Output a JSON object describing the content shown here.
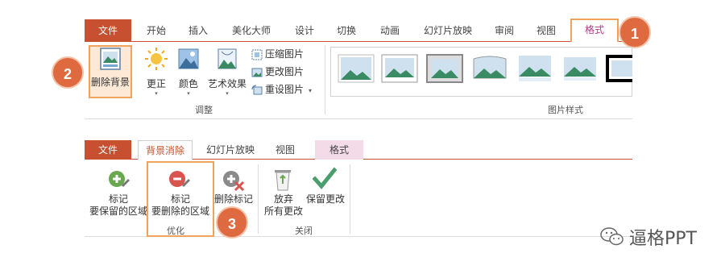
{
  "ribbon_top": {
    "tabs": [
      "文件",
      "开始",
      "插入",
      "美化大师",
      "设计",
      "切换",
      "动画",
      "幻灯片放映",
      "审阅",
      "视图",
      "格式"
    ],
    "buttons": {
      "remove_bg": "删除背景",
      "correct": "更正",
      "color": "颜色",
      "artistic": "艺术效果",
      "compress": "压缩图片",
      "change": "更改图片",
      "reset": "重设图片"
    },
    "groups": {
      "adjust": "调整",
      "picture_styles": "图片样式"
    }
  },
  "ribbon_bottom": {
    "tabs": [
      "文件",
      "背景消除",
      "幻灯片放映",
      "视图",
      "格式"
    ],
    "buttons": {
      "mark_keep_1": "标记",
      "mark_keep_2": "要保留的区域",
      "mark_remove_1": "标记",
      "mark_remove_2": "要删除的区域",
      "delete_mark": "删除标记",
      "discard_1": "放弃",
      "discard_2": "所有更改",
      "keep_changes": "保留更改"
    },
    "groups": {
      "refine": "优化",
      "close": "关闭"
    }
  },
  "callouts": [
    "1",
    "2",
    "3"
  ],
  "watermark": "逼格PPT",
  "colors": {
    "accent": "#c6502f",
    "highlight": "#f0a35d",
    "callout": "#e06a40"
  }
}
